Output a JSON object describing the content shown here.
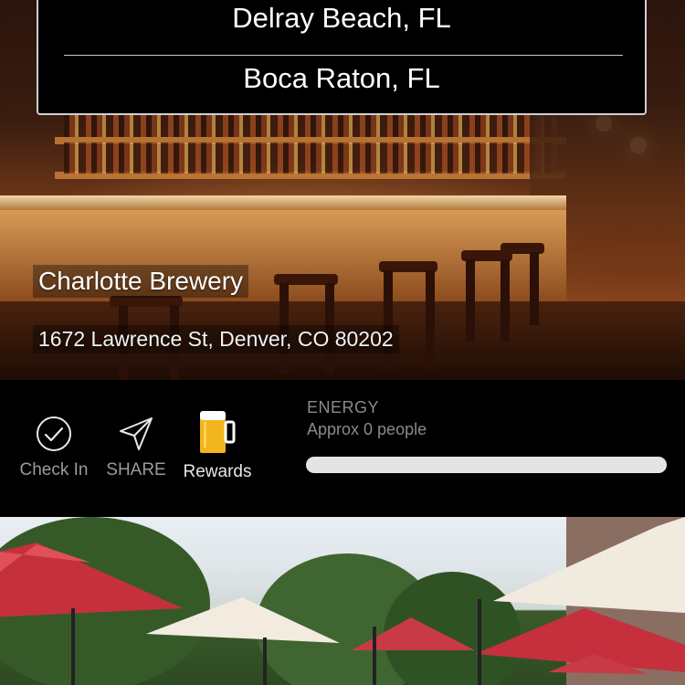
{
  "location_dropdown": {
    "options": [
      "Delray Beach, FL",
      "Boca Raton, FL"
    ]
  },
  "venue": {
    "name": "Charlotte Brewery",
    "address": "1672 Lawrence St, Denver, CO 80202"
  },
  "actions": {
    "check_in_label": "Check In",
    "share_label": "SHARE",
    "rewards_label": "Rewards",
    "check_in_icon": "check-circle-icon",
    "share_icon": "paper-plane-icon",
    "rewards_icon": "beer-mug-icon"
  },
  "energy": {
    "title": "ENERGY",
    "subtitle": "Approx 0 people",
    "level_percent": 0
  },
  "colors": {
    "background": "#000000",
    "energy_track": "#e4e4e4",
    "beer": "#f2b51c"
  }
}
